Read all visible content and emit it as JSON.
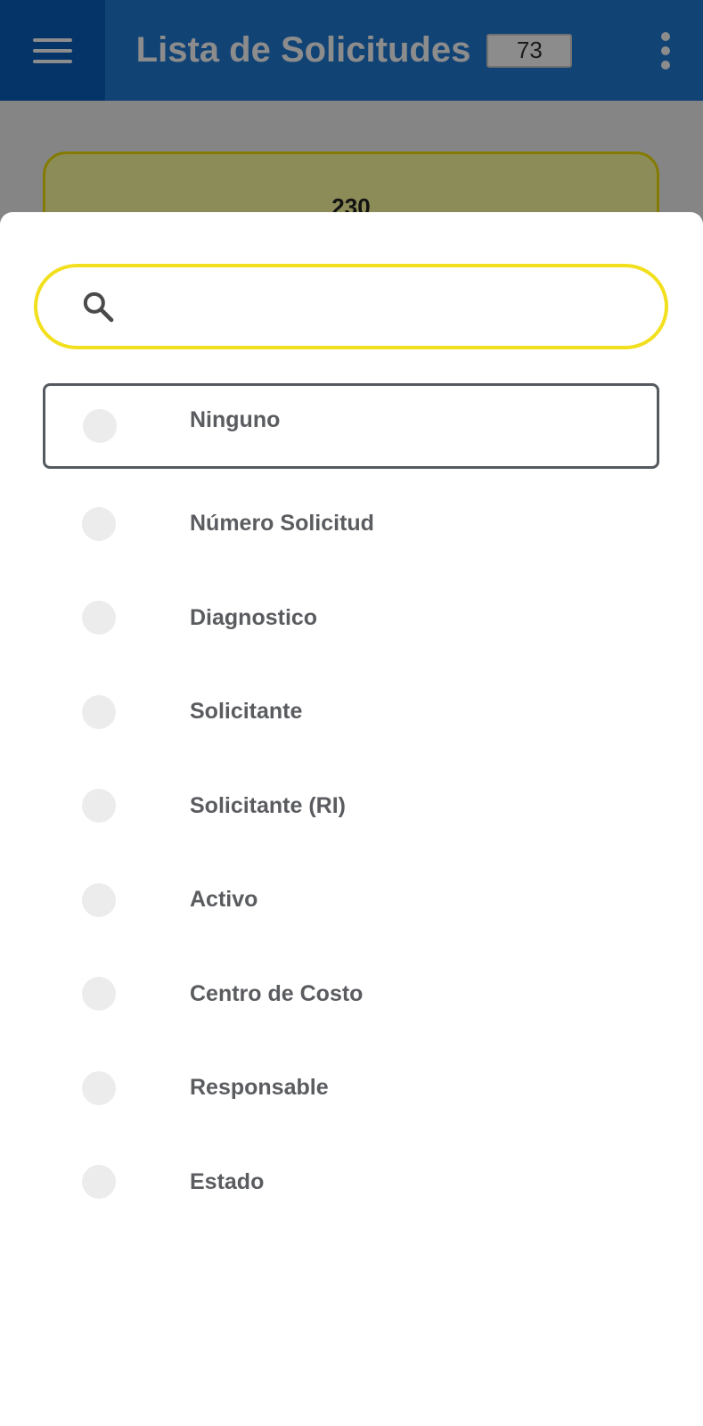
{
  "app_bar": {
    "title": "Lista de Solicitudes",
    "count": "73",
    "menu_icon": "hamburger-menu-icon",
    "overflow_icon": "more-vert-icon",
    "color": "#1f7ad6",
    "menu_color": "#0a5fc0"
  },
  "background_card": {
    "number": "230",
    "fill": "#ffffa0",
    "border": "#f0e000"
  },
  "sheet": {
    "search": {
      "placeholder": "",
      "value": "",
      "icon": "search-icon",
      "border_color": "#f2e01f"
    },
    "options": [
      {
        "label": "Ninguno",
        "focused": true
      },
      {
        "label": "Número Solicitud",
        "focused": false
      },
      {
        "label": "Diagnostico",
        "focused": false
      },
      {
        "label": "Solicitante",
        "focused": false
      },
      {
        "label": "Solicitante (RI)",
        "focused": false
      },
      {
        "label": "Activo",
        "focused": false
      },
      {
        "label": "Centro de Costo",
        "focused": false
      },
      {
        "label": "Responsable",
        "focused": false
      },
      {
        "label": "Estado",
        "focused": false
      }
    ]
  }
}
